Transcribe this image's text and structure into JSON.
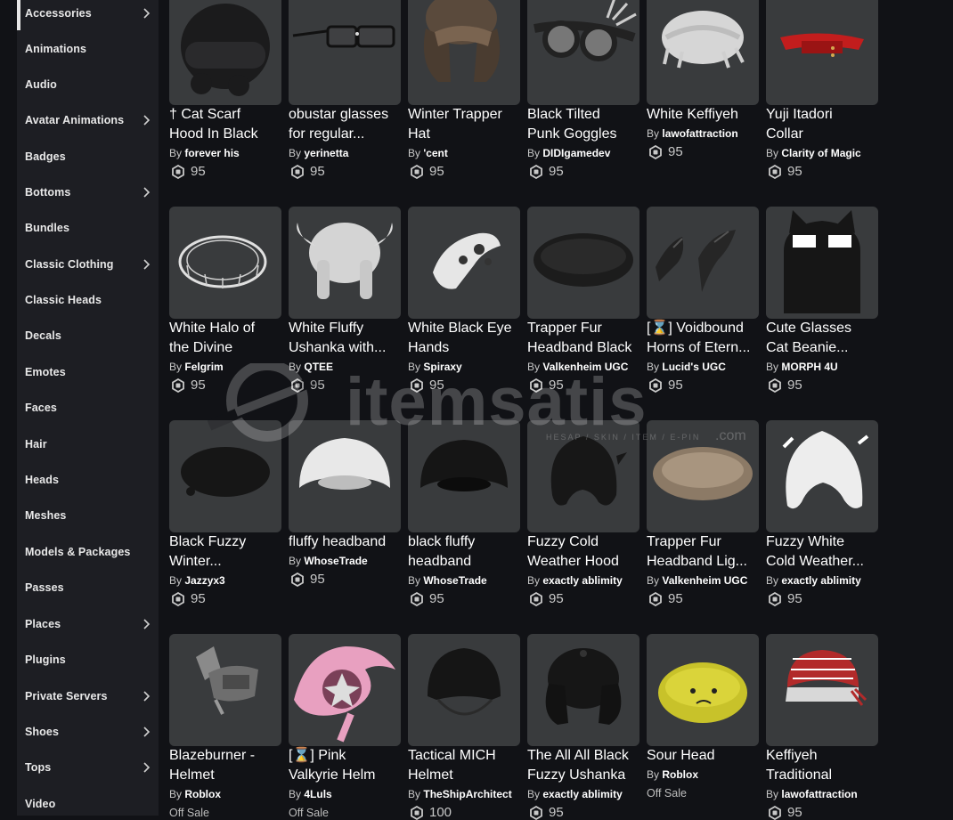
{
  "sidebar": {
    "items": [
      {
        "label": "Accessories",
        "chevron": true,
        "active": true
      },
      {
        "label": "Animations",
        "chevron": false
      },
      {
        "label": "Audio",
        "chevron": false
      },
      {
        "label": "Avatar Animations",
        "chevron": true
      },
      {
        "label": "Badges",
        "chevron": false
      },
      {
        "label": "Bottoms",
        "chevron": true
      },
      {
        "label": "Bundles",
        "chevron": false
      },
      {
        "label": "Classic Clothing",
        "chevron": true
      },
      {
        "label": "Classic Heads",
        "chevron": false
      },
      {
        "label": "Decals",
        "chevron": false
      },
      {
        "label": "Emotes",
        "chevron": false
      },
      {
        "label": "Faces",
        "chevron": false
      },
      {
        "label": "Hair",
        "chevron": false
      },
      {
        "label": "Heads",
        "chevron": false
      },
      {
        "label": "Meshes",
        "chevron": false
      },
      {
        "label": "Models & Packages",
        "chevron": false
      },
      {
        "label": "Passes",
        "chevron": false
      },
      {
        "label": "Places",
        "chevron": true
      },
      {
        "label": "Plugins",
        "chevron": false
      },
      {
        "label": "Private Servers",
        "chevron": true
      },
      {
        "label": "Shoes",
        "chevron": true
      },
      {
        "label": "Tops",
        "chevron": true
      },
      {
        "label": "Video",
        "chevron": false
      }
    ]
  },
  "by_label": "By",
  "items": [
    {
      "name1": "† Cat Scarf",
      "name2": "Hood In Black",
      "creator": "forever his",
      "price": "95",
      "icon": "cat-scarf-hood-icon"
    },
    {
      "name1": "obustar glasses",
      "name2": "for regular...",
      "creator": "yerinetta",
      "price": "95",
      "icon": "glasses-icon"
    },
    {
      "name1": "Winter Trapper",
      "name2": "Hat",
      "creator": "'cent",
      "price": "95",
      "icon": "trapper-hat-icon"
    },
    {
      "name1": "Black Tilted",
      "name2": "Punk Goggles",
      "creator": "DIDIgamedev",
      "price": "95",
      "icon": "goggles-icon"
    },
    {
      "name1": "White Keffiyeh",
      "name2": "",
      "creator": "lawofattraction",
      "price": "95",
      "icon": "keffiyeh-white-icon"
    },
    {
      "name1": "Yuji Itadori",
      "name2": "Collar",
      "creator": "Clarity of Magic",
      "price": "95",
      "icon": "collar-icon"
    },
    {
      "name1": "White Halo of",
      "name2": "the Divine",
      "creator": "Felgrim",
      "price": "95",
      "icon": "halo-icon"
    },
    {
      "name1": "White Fluffy",
      "name2": "Ushanka with...",
      "creator": "QTEE",
      "price": "95",
      "icon": "ushanka-white-icon"
    },
    {
      "name1": "White Black Eye",
      "name2": "Hands",
      "creator": "Spiraxy",
      "price": "95",
      "icon": "eye-hands-icon"
    },
    {
      "name1": "Trapper Fur",
      "name2": "Headband Black",
      "creator": "Valkenheim UGC",
      "price": "95",
      "icon": "fur-headband-black-icon"
    },
    {
      "name1": "[⌛] Voidbound",
      "name2": "Horns of Etern...",
      "creator": "Lucid's UGC",
      "price": "95",
      "icon": "horns-icon"
    },
    {
      "name1": "Cute Glasses",
      "name2": "Cat Beanie...",
      "creator": "MORPH 4U",
      "price": "95",
      "icon": "cat-beanie-icon"
    },
    {
      "name1": "Black Fuzzy",
      "name2": "Winter...",
      "creator": "Jazzyx3",
      "price": "95",
      "icon": "fuzzy-winter-black-icon"
    },
    {
      "name1": "fluffy headband",
      "name2": "",
      "creator": "WhoseTrade",
      "price": "95",
      "icon": "fluffy-headband-white-icon"
    },
    {
      "name1": "black fluffy",
      "name2": "headband",
      "creator": "WhoseTrade",
      "price": "95",
      "icon": "fluffy-headband-black-icon"
    },
    {
      "name1": "Fuzzy Cold",
      "name2": "Weather Hood",
      "creator": "exactly ablimity",
      "price": "95",
      "icon": "weather-hood-black-icon"
    },
    {
      "name1": "Trapper Fur",
      "name2": "Headband Lig...",
      "creator": "Valkenheim UGC",
      "price": "95",
      "icon": "fur-headband-light-icon"
    },
    {
      "name1": "Fuzzy White",
      "name2": "Cold Weather...",
      "creator": "exactly ablimity",
      "price": "95",
      "icon": "weather-hood-white-icon"
    },
    {
      "name1": "Blazeburner -",
      "name2": "Helmet",
      "creator": "Roblox",
      "price": "Off Sale",
      "icon": "blazeburner-helmet-icon"
    },
    {
      "name1": "[⌛] Pink",
      "name2": "Valkyrie Helm",
      "creator": "4Luls",
      "price": "Off Sale",
      "icon": "valkyrie-helm-icon"
    },
    {
      "name1": "Tactical MICH",
      "name2": "Helmet",
      "creator": "TheShipArchitect",
      "price": "100",
      "icon": "tactical-helmet-icon"
    },
    {
      "name1": "The All All Black",
      "name2": "Fuzzy Ushanka",
      "creator": "exactly ablimity",
      "price": "95",
      "icon": "ushanka-black-icon"
    },
    {
      "name1": "Sour Head",
      "name2": "",
      "creator": "Roblox",
      "price": "Off Sale",
      "icon": "sour-head-icon"
    },
    {
      "name1": "Keffiyeh",
      "name2": "Traditional",
      "creator": "lawofattraction",
      "price": "95",
      "icon": "keffiyeh-red-icon"
    }
  ],
  "watermark": {
    "text": "itemsatis",
    "sub": "HESAP / SKIN / ITEM / E-PIN",
    "com": ".com"
  }
}
